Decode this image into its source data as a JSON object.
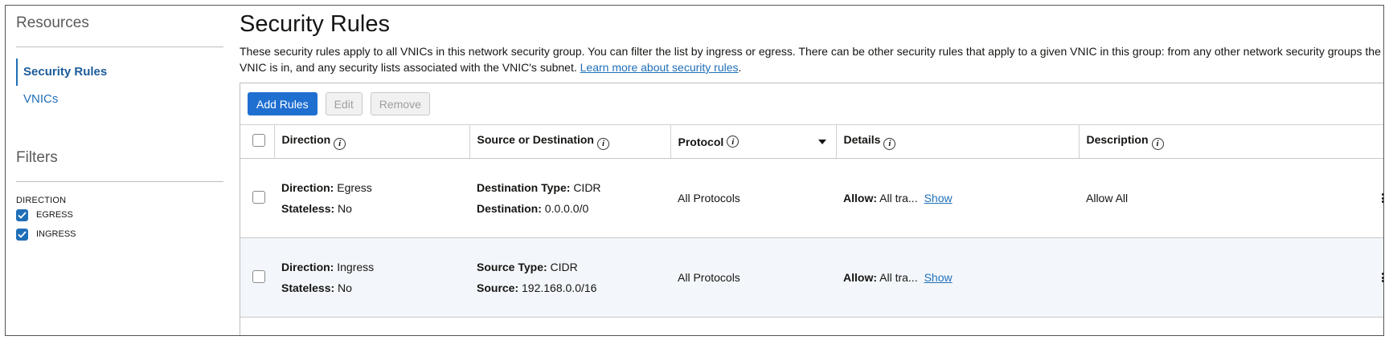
{
  "sidebar": {
    "resources_heading": "Resources",
    "nav": [
      {
        "label": "Security Rules",
        "active": true
      },
      {
        "label": "VNICs",
        "active": false
      }
    ],
    "filters_heading": "Filters",
    "direction_label": "DIRECTION",
    "direction_options": [
      {
        "label": "EGRESS",
        "checked": true
      },
      {
        "label": "INGRESS",
        "checked": true
      }
    ]
  },
  "main": {
    "title": "Security Rules",
    "intro_text": "These security rules apply to all VNICs in this network security group. You can filter the list by ingress or egress. There can be other security rules that apply to a given VNIC in this group: from any other network security groups the VNIC is in, and any security lists associated with the VNIC's subnet. ",
    "learn_more_link": "Learn more about security rules",
    "intro_end": "."
  },
  "toolbar": {
    "add_label": "Add Rules",
    "edit_label": "Edit",
    "remove_label": "Remove"
  },
  "table": {
    "headers": {
      "direction": "Direction",
      "source_dest": "Source or Destination",
      "protocol": "Protocol",
      "details": "Details",
      "description": "Description"
    },
    "rows": [
      {
        "direction_key": "Direction:",
        "direction_val": "Egress",
        "stateless_key": "Stateless:",
        "stateless_val": "No",
        "type_key": "Destination Type:",
        "type_val": "CIDR",
        "addr_key": "Destination:",
        "addr_val": "0.0.0.0/0",
        "protocol": "All Protocols",
        "allow_key": "Allow:",
        "allow_val": "All tra...",
        "show_label": "Show",
        "description": "Allow All"
      },
      {
        "direction_key": "Direction:",
        "direction_val": "Ingress",
        "stateless_key": "Stateless:",
        "stateless_val": "No",
        "type_key": "Source Type:",
        "type_val": "CIDR",
        "addr_key": "Source:",
        "addr_val": "192.168.0.0/16",
        "protocol": "All Protocols",
        "allow_key": "Allow:",
        "allow_val": "All tra...",
        "show_label": "Show",
        "description": ""
      }
    ]
  },
  "info_icon_glyph": "i",
  "colors": {
    "accent": "#1f6fb8",
    "primary_button": "#1f6fd1",
    "alt_row": "#f3f7fb"
  }
}
